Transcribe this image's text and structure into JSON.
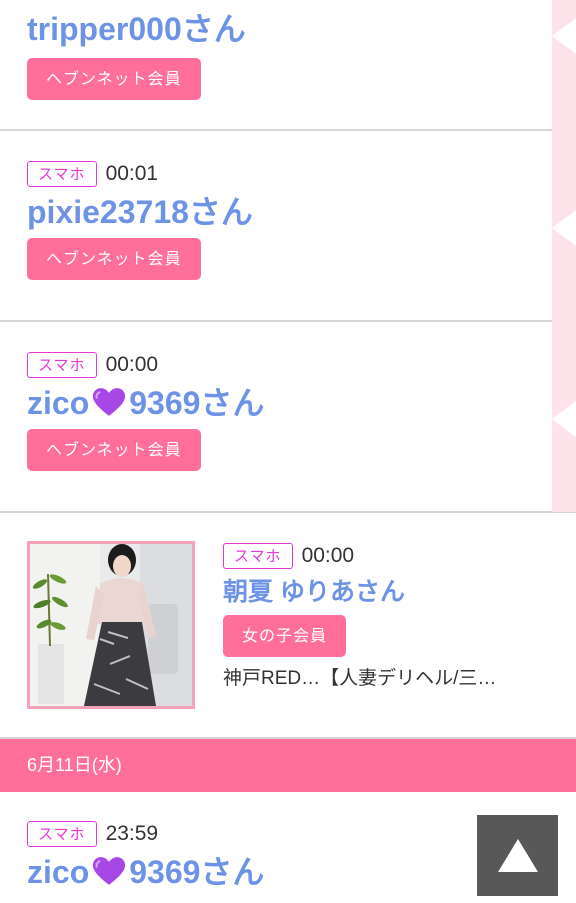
{
  "entries": [
    {
      "device": "",
      "time": "",
      "name": "tripper000さん",
      "member_type": "ヘブンネット会員"
    },
    {
      "device": "スマホ",
      "time": "00:01",
      "name": "pixie23718さん",
      "member_type": "ヘブンネット会員"
    },
    {
      "device": "スマホ",
      "time": "00:00",
      "name_prefix": "zico",
      "name_icon": "purple-heart-icon",
      "name_suffix": "9369さん",
      "member_type": "ヘブンネット会員"
    },
    {
      "device": "スマホ",
      "time": "00:00",
      "name": "朝夏 ゆりあさん",
      "member_type": "女の子会員",
      "shop": "神戸RED…【人妻デリヘル/三…",
      "photo_icon": "profile-photo"
    }
  ],
  "date_header": "6月11日(水)",
  "last_entry": {
    "device": "スマホ",
    "time": "23:59",
    "name_prefix": "zico",
    "name_icon": "purple-heart-icon",
    "name_suffix": "9369さん"
  },
  "colors": {
    "accent": "#ff6f99",
    "name": "#6e93e6",
    "device_badge": "#e838d8",
    "strip": "#ffe3ea"
  },
  "scroll_top_icon": "triangle-up-icon"
}
